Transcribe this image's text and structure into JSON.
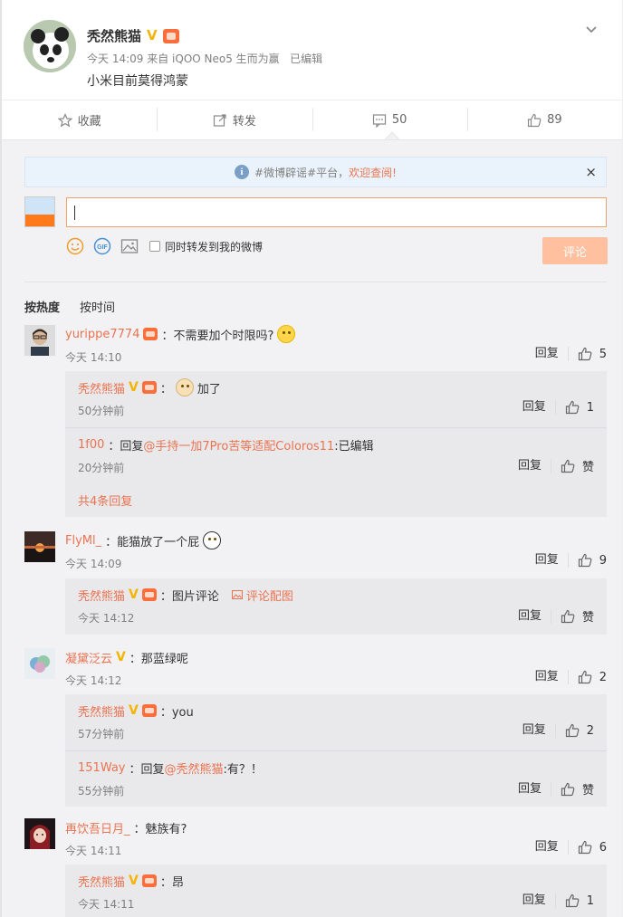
{
  "post": {
    "author": "秃然熊猫",
    "verified_mark": "V",
    "time": "今天 14:09",
    "source": "来自 iQOO Neo5 生而为赢",
    "edited": "已编辑",
    "text": "小米目前莫得鸿蒙"
  },
  "actions": {
    "favorite": "收藏",
    "repost": "转发",
    "comment_count": "50",
    "like_count": "89"
  },
  "notice": {
    "text": "#微博辟谣#平台，",
    "link": "欢迎查阅!",
    "close": "×"
  },
  "composer": {
    "repost_label": "同时转发到我的微博",
    "submit": "评论"
  },
  "sort": {
    "hot": "按热度",
    "time": "按时间"
  },
  "comments": [
    {
      "user": "yurippe7774",
      "text": "：不需要加个时限吗?",
      "time": "今天 14:10",
      "reply": "回复",
      "likes": "5",
      "replies": [
        {
          "user": "秃然熊猫",
          "text": "加了",
          "time": "50分钟前",
          "reply": "回复",
          "likes": "1"
        },
        {
          "user": "1f00",
          "prefix": "：回复",
          "mention": "@手持一加7Pro苦等适配Coloros11",
          "text": ":已编辑",
          "time": "20分钟前",
          "reply": "回复",
          "likes": "赞"
        }
      ],
      "more": "共4条回复"
    },
    {
      "user": "FlyMl_",
      "text": "：能猫放了一个屁",
      "time": "今天 14:09",
      "reply": "回复",
      "likes": "9",
      "replies": [
        {
          "user": "秃然熊猫",
          "text": "：图片评论",
          "img_link": "评论配图",
          "time": "今天 14:12",
          "reply": "回复",
          "likes": "赞"
        }
      ]
    },
    {
      "user": "凝黛泛云",
      "text": "：那蓝绿呢",
      "time": "今天 14:12",
      "reply": "回复",
      "likes": "2",
      "replies": [
        {
          "user": "秃然熊猫",
          "text": "：you",
          "time": "57分钟前",
          "reply": "回复",
          "likes": "2"
        },
        {
          "user": "151Way",
          "prefix": "：回复",
          "mention": "@秃然熊猫",
          "text": ":有？！",
          "time": "55分钟前",
          "reply": "回复",
          "likes": "赞"
        }
      ]
    },
    {
      "user": "再饮吾日月_",
      "text": "：魅族有?",
      "time": "今天 14:11",
      "reply": "回复",
      "likes": "6",
      "replies": [
        {
          "user": "秃然熊猫",
          "text": "：昂",
          "time": "今天 14:11",
          "reply": "回复",
          "likes": "1"
        }
      ]
    }
  ],
  "colors": {
    "accent": "#eb7350",
    "verified": "#f4b400",
    "background": "#f2f2f5",
    "submit_disabled": "#ffc09f"
  },
  "icons": [
    "chevron-down-icon",
    "star-icon",
    "repost-icon",
    "comment-icon",
    "thumb-up-icon",
    "info-icon",
    "smile-icon",
    "gif-icon",
    "image-icon"
  ]
}
